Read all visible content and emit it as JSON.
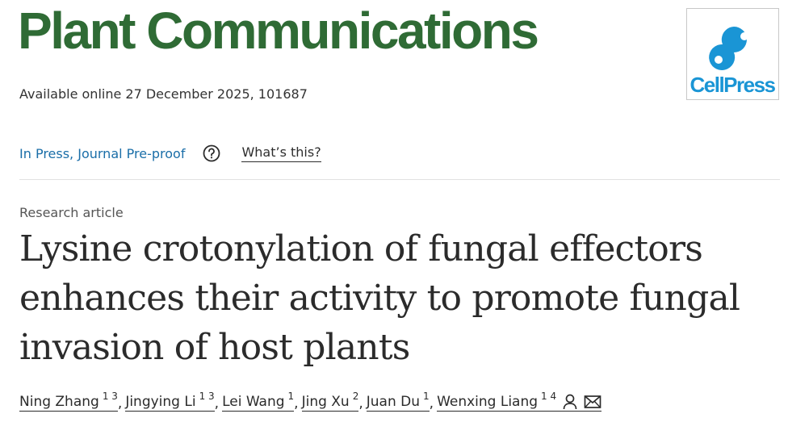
{
  "journal": {
    "title": "Plant Communications"
  },
  "logo": {
    "text": "CellPress",
    "color": "#1a95d5"
  },
  "publication": {
    "available_online": "Available online 27 December 2025, 101687"
  },
  "status": {
    "label": "In Press, Journal Pre-proof",
    "help_label": "What’s this?"
  },
  "article": {
    "type": "Research article",
    "title": "Lysine crotonylation of fungal effectors enhances their activity to promote fungal invasion of host plants"
  },
  "authors": [
    {
      "name": "Ning Zhang",
      "affiliations": "1 3"
    },
    {
      "name": "Jingying Li",
      "affiliations": "1 3"
    },
    {
      "name": "Lei Wang",
      "affiliations": "1"
    },
    {
      "name": "Jing Xu",
      "affiliations": "2"
    },
    {
      "name": "Juan Du",
      "affiliations": "1"
    },
    {
      "name": "Wenxing Liang",
      "affiliations": "1 4"
    }
  ],
  "colors": {
    "journal_green": "#2f6b35",
    "link_blue": "#1a6ea8"
  },
  "icons": [
    "help-icon",
    "person-icon",
    "envelope-icon"
  ]
}
